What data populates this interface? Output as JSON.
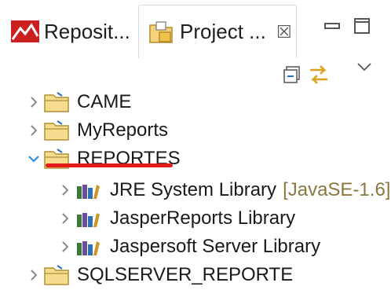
{
  "tabs": [
    {
      "label": "Reposit...",
      "icon": "repository-explorer-icon",
      "active": false
    },
    {
      "label": "Project ...",
      "icon": "project-explorer-icon",
      "active": true,
      "close": "☒"
    }
  ],
  "tree": {
    "items": [
      {
        "label": "CAME",
        "expanded": false
      },
      {
        "label": "MyReports",
        "expanded": false
      },
      {
        "label": "REPORTES",
        "expanded": true,
        "highlighted": true,
        "children": [
          {
            "label": "JRE System Library",
            "decoration": "[JavaSE-1.6]"
          },
          {
            "label": "JasperReports Library"
          },
          {
            "label": "Jaspersoft Server Library"
          }
        ]
      },
      {
        "label": "SQLSERVER_REPORTE",
        "expanded": false
      }
    ]
  },
  "colors": {
    "accent": "#e21a1a",
    "chevron_expanded": "#2f8de4",
    "decoration": "#8b7740"
  }
}
